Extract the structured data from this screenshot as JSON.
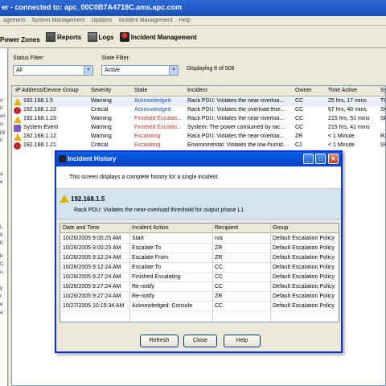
{
  "window": {
    "title": "er - connected to: apc_00C0B7A4718C.ams.apc.com"
  },
  "menu": [
    "agement",
    "System Management",
    "Updates",
    "Incident Management",
    "Help"
  ],
  "toolbar": {
    "power_zones": "Power Zones",
    "reports": "Reports",
    "logs": "Logs",
    "incident_management": "Incident Management"
  },
  "sidebar_fragments": [
    "a",
    "it",
    "on",
    "is",
    "py",
    "it",
    "a",
    "e",
    "L",
    "5",
    "E",
    "b",
    "C",
    "o",
    "y",
    "r",
    "e",
    "a"
  ],
  "filters": {
    "status_label": "Status Filter:",
    "status_value": "All",
    "state_label": "State Filter:",
    "state_value": "Active",
    "displaying": "Displaying 6 of 506"
  },
  "table": {
    "columns": [
      "IP Address/Device Group",
      "Severity",
      "State",
      "Incident",
      "Owner",
      "Time Active",
      "Sy"
    ],
    "rows": [
      {
        "ip": "192.168.1.5",
        "icon": "warning",
        "severity": "Warning",
        "state": "Acknowledged",
        "incident": "Rack PDU: Violates the near-overloa...",
        "owner": "CC",
        "time": "25 hrs, 17 mins",
        "sys": "TC"
      },
      {
        "ip": "192.168.1.22",
        "icon": "critical",
        "severity": "Critical",
        "state": "Acknowledged",
        "incident": "Rack PDU: Violates the overload thre...",
        "owner": "CC",
        "time": "67 hrs, 40 mins",
        "sys": "SC"
      },
      {
        "ip": "192.168.1.23",
        "icon": "warning",
        "severity": "Warning",
        "state": "Finished Escalati...",
        "incident": "Rack PDU: Violates the near-overloa...",
        "owner": "CC",
        "time": "215 hrs, 51 mins",
        "sys": "SR"
      },
      {
        "ip": "System Event",
        "icon": "system",
        "severity": "Warning",
        "state": "Finished Escalati...",
        "incident": "System: The power consumed by rac...",
        "owner": "CC",
        "time": "215 hrs, 41 mins",
        "sys": ""
      },
      {
        "ip": "192.168.1.12",
        "icon": "warning",
        "severity": "Warning",
        "state": "Escalating",
        "incident": "Rack PDU: Violates the near-overloa...",
        "owner": "ZR",
        "time": "< 1 Minute",
        "sys": "R2"
      },
      {
        "ip": "192.168.1.21",
        "icon": "critical",
        "severity": "Critical",
        "state": "Escalating",
        "incident": "Environmental: Violates the low-humid...",
        "owner": "CJ",
        "time": "< 1 Minute",
        "sys": "SC"
      }
    ]
  },
  "dialog": {
    "title": "Incident History",
    "description": "This screen displays a complete history for a single incident.",
    "ip": "192.168.1.5",
    "message": "Rack PDU: Violates the near-overload threshold for output phase L1",
    "columns": [
      "Date and Time",
      "Incident Action",
      "Recipient",
      "Group"
    ],
    "rows": [
      {
        "datetime": "10/26/2005 9:00:25 AM",
        "action": "Start",
        "recipient": "n/a",
        "group": "Default Escalation Policy"
      },
      {
        "datetime": "10/26/2005 9:00:25 AM",
        "action": "Escalate To",
        "recipient": "ZR",
        "group": "Default Escalation Policy"
      },
      {
        "datetime": "10/26/2005 9:12:24 AM",
        "action": "Escalate From",
        "recipient": "ZR",
        "group": "Default Escalation Policy"
      },
      {
        "datetime": "10/26/2005 9:12:24 AM",
        "action": "Escalate To",
        "recipient": "CC",
        "group": "Default Escalation Policy"
      },
      {
        "datetime": "10/26/2005 9:27:24 AM",
        "action": "Finished Escalating",
        "recipient": "CC",
        "group": "Default Escalation Policy"
      },
      {
        "datetime": "10/26/2005 9:27:24 AM",
        "action": "Re-notify",
        "recipient": "CC",
        "group": "Default Escalation Policy"
      },
      {
        "datetime": "10/26/2005 9:27:24 AM",
        "action": "Re-notify",
        "recipient": "ZR",
        "group": "Default Escalation Policy"
      },
      {
        "datetime": "10/27/2005 10:15:34 AM",
        "action": "Acknowledged: Console",
        "recipient": "CC",
        "group": "Default Escalation Policy"
      }
    ],
    "buttons": {
      "refresh": "Refresh",
      "close": "Close",
      "help": "Help"
    }
  }
}
